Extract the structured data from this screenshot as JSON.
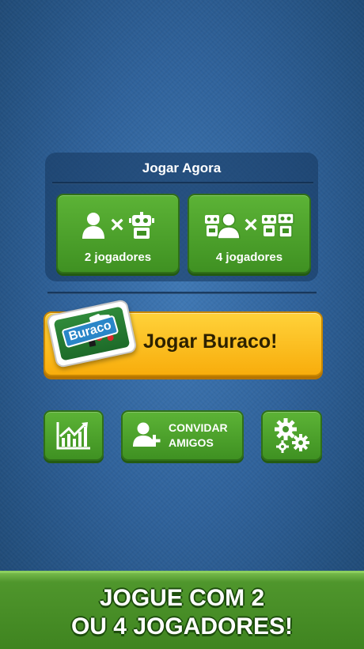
{
  "play_now": {
    "title": "Jogar Agora",
    "two_players_label": "2 jogadores",
    "four_players_label": "4 jogadores"
  },
  "main_play": {
    "label": "Jogar Buraco!",
    "app_logo_text": "Buraco"
  },
  "actions": {
    "invite_line1": "CONVIDAR",
    "invite_line2": "AMIGOS"
  },
  "banner": {
    "line1": "JOGUE COM 2",
    "line2": "OU 4 JOGADORES!"
  },
  "colors": {
    "background": "#2f629b",
    "green_button": "#4ea32b",
    "yellow_button": "#fbbf1f",
    "banner_green": "#4f962c"
  }
}
